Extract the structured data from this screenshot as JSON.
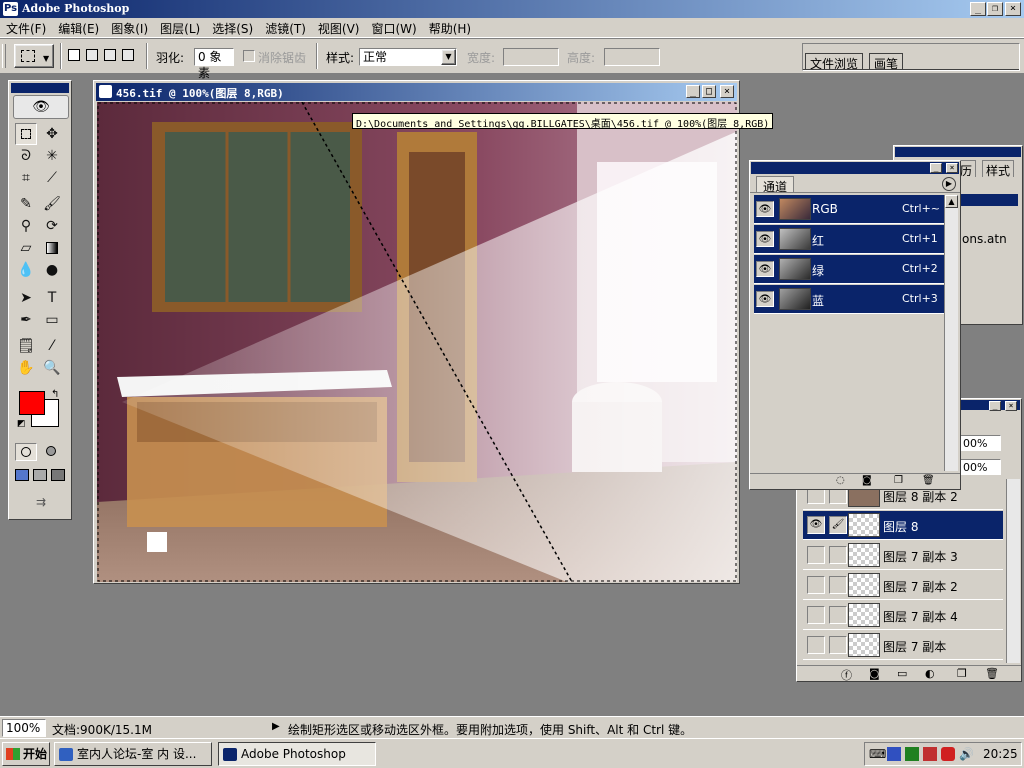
{
  "app": {
    "title": "Adobe Photoshop",
    "icon_letter": "Ps"
  },
  "window_controls": {
    "minimize": "_",
    "restore": "❐",
    "close": "×"
  },
  "menu": [
    "文件(F)",
    "编辑(E)",
    "图象(I)",
    "图层(L)",
    "选择(S)",
    "滤镜(T)",
    "视图(V)",
    "窗口(W)",
    "帮助(H)"
  ],
  "options": {
    "feather_label": "羽化:",
    "feather_value": "0 象素",
    "antialias_label": "消除锯齿",
    "style_label": "样式:",
    "style_value": "正常",
    "width_label": "宽度:",
    "height_label": "高度:",
    "palette_tabs": [
      "文件浏览",
      "画笔"
    ]
  },
  "document": {
    "title": "456.tif @ 100%(图层 8,RGB)",
    "tooltip": "D:\\Documents and Settings\\gg.BILLGATES\\桌面\\456.tif @ 100%(图层 8,RGB)"
  },
  "channels": {
    "tab": "通道",
    "rows": [
      {
        "name": "RGB",
        "shortcut": "Ctrl+~"
      },
      {
        "name": "红",
        "shortcut": "Ctrl+1"
      },
      {
        "name": "绿",
        "shortcut": "Ctrl+2"
      },
      {
        "name": "蓝",
        "shortcut": "Ctrl+3"
      }
    ]
  },
  "behind_panels": {
    "tab_partial_1": "历",
    "tab_partial_2": "样式",
    "actions_text": "ons.atn",
    "opacity_1": "00%",
    "opacity_2": "00%"
  },
  "layers": [
    {
      "name": "图层 8 副本 2",
      "selected": false
    },
    {
      "name": "图层 8",
      "selected": true
    },
    {
      "name": "图层 7 副本 3",
      "selected": false
    },
    {
      "name": "图层 7 副本 2",
      "selected": false
    },
    {
      "name": "图层 7 副本 4",
      "selected": false
    },
    {
      "name": "图层 7 副本",
      "selected": false
    }
  ],
  "status": {
    "zoom": "100%",
    "doc_size": "文档:900K/15.1M",
    "hint": "绘制矩形选区或移动选区外框。要用附加选项，使用 Shift、Alt 和 Ctrl 键。"
  },
  "taskbar": {
    "start": "开始",
    "tasks": [
      "室内人论坛-室 内 设...",
      "Adobe Photoshop"
    ],
    "clock": "20:25"
  },
  "colors": {
    "foreground": "#ff0000",
    "background": "#ffffff",
    "titlebar": "#0a246a",
    "selection": "#0a246a"
  }
}
